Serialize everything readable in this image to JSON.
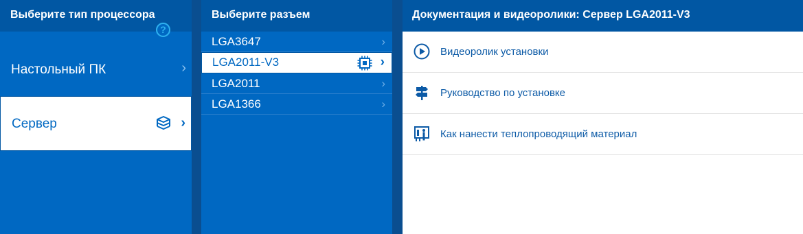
{
  "colors": {
    "panel_blue": "#0068c2",
    "header_blue": "#0157a3",
    "divider_blue": "#0a4e90",
    "help_cyan": "#2fb2f0",
    "link_blue": "#0c5aa6"
  },
  "processor_column": {
    "title": "Выберите тип процессора",
    "help_symbol": "?",
    "items": [
      {
        "label": "Настольный ПК",
        "icon": "chevron-right-icon",
        "selected": false
      },
      {
        "label": "Сервер",
        "icon": "server-stack-icon",
        "selected": true
      }
    ]
  },
  "socket_column": {
    "title": "Выберите разъем",
    "help_symbol": "?",
    "items": [
      {
        "label": "LGA3647",
        "selected": false
      },
      {
        "label": "LGA2011-V3",
        "selected": true,
        "icon": "processor-chip-icon"
      },
      {
        "label": "LGA2011",
        "selected": false
      },
      {
        "label": "LGA1366",
        "selected": false
      }
    ]
  },
  "docs_column": {
    "title": "Документация и видеоролики: Сервер LGA2011-V3",
    "items": [
      {
        "label": "Видеоролик установки",
        "icon": "play-video-icon"
      },
      {
        "label": "Руководство по установке",
        "icon": "signpost-icon"
      },
      {
        "label": "Как нанести теплопроводящий материал",
        "icon": "presentation-board-icon"
      }
    ]
  },
  "chevron": "›"
}
